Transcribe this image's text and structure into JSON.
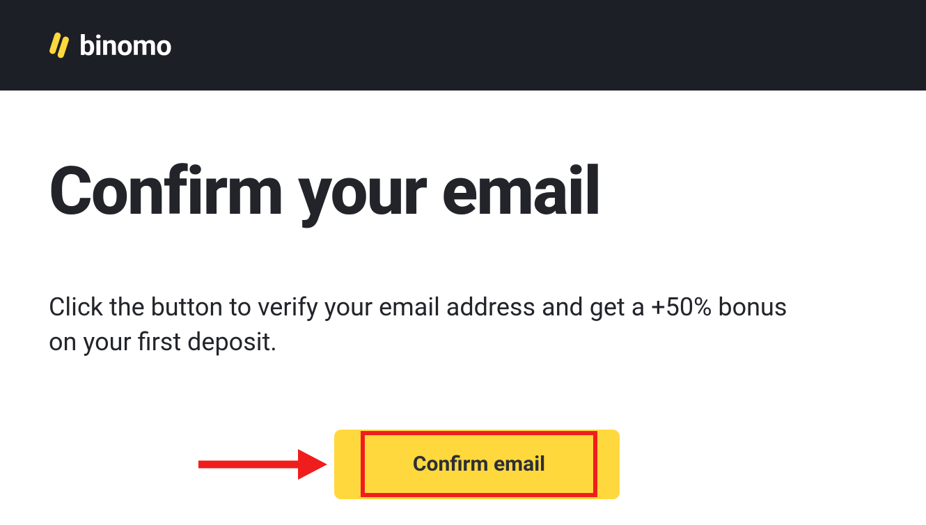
{
  "header": {
    "logo_text": "binomo"
  },
  "main": {
    "heading": "Confirm your email",
    "body": "Click the button to verify your email address and get a +50% bonus on your first deposit.",
    "confirm_button_label": "Confirm email"
  },
  "colors": {
    "header_bg": "#1d1f26",
    "button_bg": "#ffd83d",
    "highlight_border": "#f01d1d",
    "text_dark": "#22242a"
  }
}
